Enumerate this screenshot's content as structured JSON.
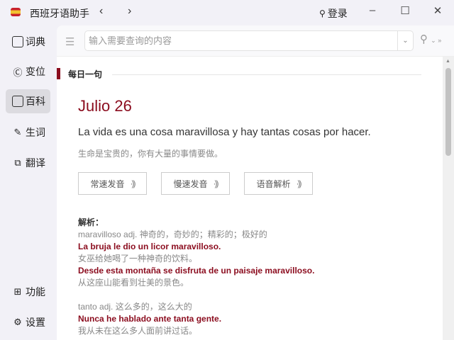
{
  "app": {
    "title": "西班牙语助手",
    "back": "‹",
    "forward": "›",
    "login": "登录",
    "minimize": "–",
    "maximize": "☐",
    "close": "✕"
  },
  "sidebar": {
    "items": [
      {
        "label": "词典"
      },
      {
        "label": "变位"
      },
      {
        "label": "百科"
      },
      {
        "label": "生词"
      },
      {
        "label": "翻译"
      },
      {
        "label": "功能"
      },
      {
        "label": "设置"
      }
    ]
  },
  "search": {
    "placeholder": "输入需要查询的内容",
    "value": ""
  },
  "daily": {
    "section_title": "每日一句",
    "date": "Julio 26",
    "sentence": "La vida es una cosa maravillosa y hay tantas cosas por hacer.",
    "translation": "生命是宝贵的，你有大量的事情要做。",
    "buttons": [
      {
        "label": "常速发音"
      },
      {
        "label": "慢速发音"
      },
      {
        "label": "语音解析"
      }
    ],
    "analysis_title": "解析：",
    "entries": [
      {
        "definition": "maravilloso adj. 神奇的，奇妙的；精彩的；极好的",
        "examples": [
          {
            "es": "La bruja le dio un licor maravilloso.",
            "zh": "女巫给她喝了一种神奇的饮料。"
          },
          {
            "es": "Desde esta montaña se disfruta de un paisaje maravilloso.",
            "zh": "从这座山能看到壮美的景色。"
          }
        ]
      },
      {
        "definition": "tanto adj. 这么多的，这么大的",
        "examples": [
          {
            "es": "Nunca he hablado ante tanta gente.",
            "zh": "我从未在这么多人面前讲过话。"
          }
        ]
      }
    ]
  },
  "colors": {
    "accent": "#8b0c1e"
  }
}
